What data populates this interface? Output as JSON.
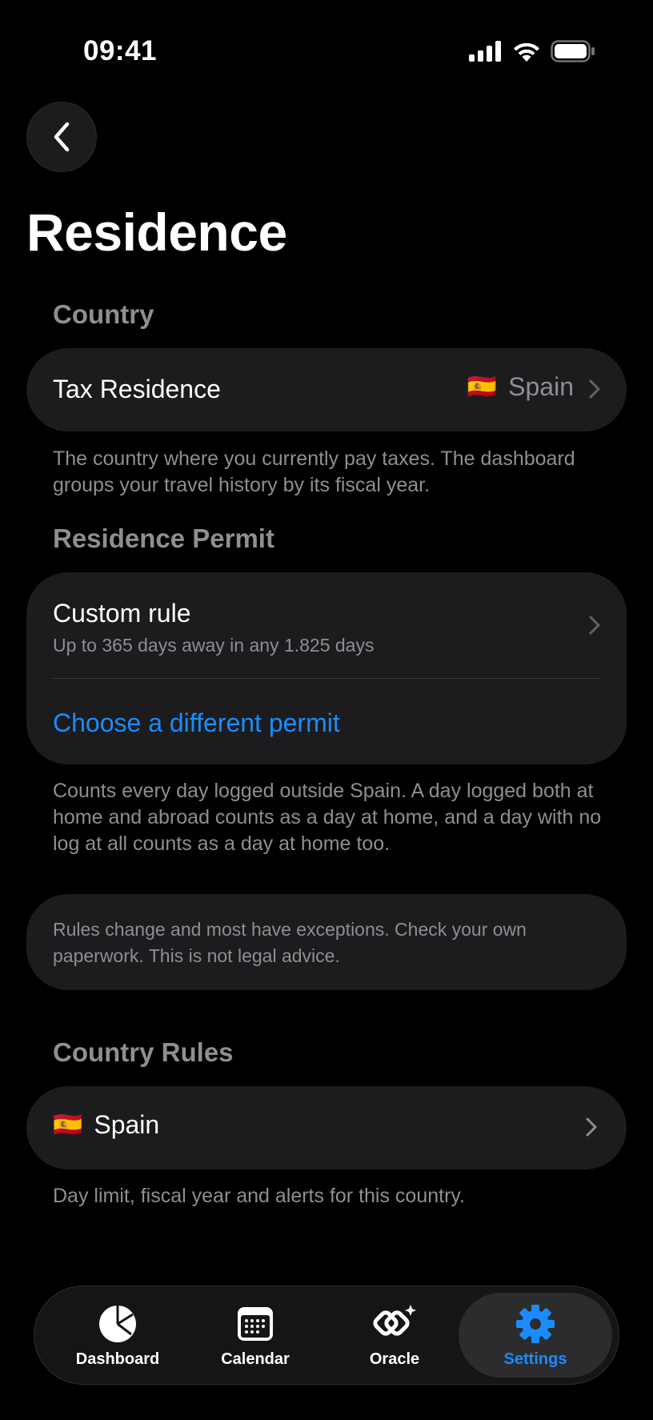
{
  "status_bar": {
    "time": "09:41"
  },
  "header": {
    "title": "Residence"
  },
  "country_section": {
    "header": "Country",
    "tax_residence": {
      "label": "Tax Residence",
      "flag": "🇪🇸",
      "value": "Spain"
    },
    "footnote": "The country where you currently pay taxes. The dashboard groups your travel history by its fiscal year."
  },
  "permit_section": {
    "header": "Residence Permit",
    "rule": {
      "title": "Custom rule",
      "subtitle": "Up to 365 days away in any 1.825 days"
    },
    "choose_link": "Choose a different permit",
    "footnote": "Counts every day logged outside Spain. A day logged both at home and abroad counts as a day at home, and a day with no log at all counts as a day at home too."
  },
  "disclaimer": "Rules change and most have exceptions. Check your own paperwork. This is not legal advice.",
  "rules_section": {
    "header": "Country Rules",
    "country": {
      "flag": "🇪🇸",
      "label": "Spain"
    },
    "footnote": "Day limit, fiscal year and alerts for this country."
  },
  "tabs": [
    {
      "label": "Dashboard",
      "icon": "pie-chart-icon"
    },
    {
      "label": "Calendar",
      "icon": "calendar-icon"
    },
    {
      "label": "Oracle",
      "icon": "oracle-sparkle-icon"
    },
    {
      "label": "Settings",
      "icon": "gear-icon",
      "active": true
    }
  ],
  "colors": {
    "accent": "#1a8cff",
    "card": "#1c1c1e",
    "secondary_text": "#8e8e93"
  }
}
